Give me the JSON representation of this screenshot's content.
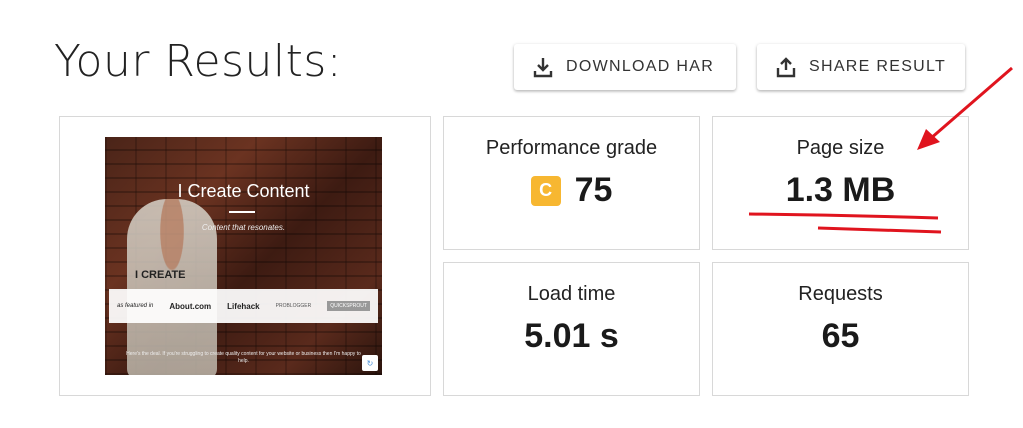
{
  "header": {
    "title": "Your Results:",
    "download_label": "DOWNLOAD HAR",
    "share_label": "SHARE RESULT"
  },
  "screenshot": {
    "headline": "I Create Content",
    "subheadline": "Content that resonates.",
    "tee_text": "I CREATE",
    "featured_label": "as featured in",
    "logos": [
      "About.com",
      "Lifehack",
      "PROBLOGGER",
      "QUICKSPROUT"
    ],
    "body_text": "Here's the deal. If you're struggling to create quality content for your website or business then I'm happy to help."
  },
  "metrics": {
    "performance": {
      "label": "Performance grade",
      "grade": "C",
      "value": "75",
      "grade_color": "#f7b731"
    },
    "page_size": {
      "label": "Page size",
      "value": "1.3 MB"
    },
    "load_time": {
      "label": "Load time",
      "value": "5.01 s"
    },
    "requests": {
      "label": "Requests",
      "value": "65"
    }
  },
  "annotation": {
    "color": "#e0141e"
  }
}
